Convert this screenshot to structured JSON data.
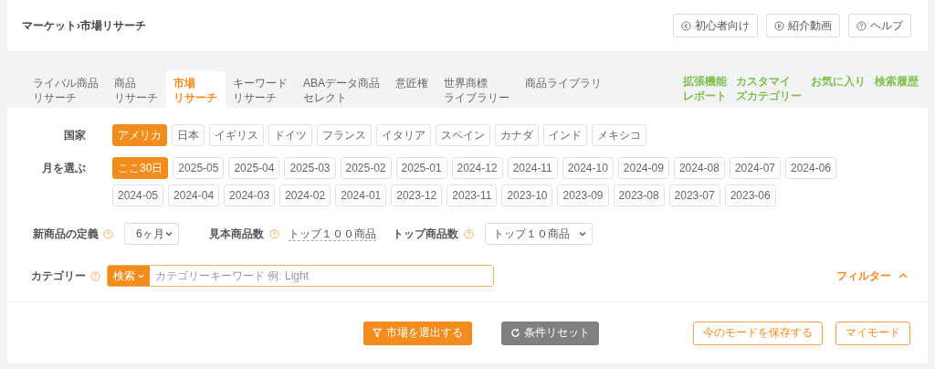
{
  "breadcrumb": "マーケット›市場リサーチ",
  "header_buttons": [
    {
      "label": "初心者向け",
      "kind": "back"
    },
    {
      "label": "紹介動画",
      "kind": "play"
    },
    {
      "label": "ヘルプ",
      "kind": "help"
    }
  ],
  "tabs": [
    {
      "lines": [
        "ライバル商品",
        "リサーチ"
      ],
      "selected": false
    },
    {
      "lines": [
        "商品",
        "リサーチ"
      ],
      "selected": false
    },
    {
      "lines": [
        "市場",
        "リサーチ"
      ],
      "selected": true
    },
    {
      "lines": [
        "キーワード",
        "リサーチ"
      ],
      "selected": false
    },
    {
      "lines": [
        "ABAデータ商品",
        "セレクト"
      ],
      "selected": false
    },
    {
      "lines": [
        "意匠権"
      ],
      "selected": false
    },
    {
      "lines": [
        "世界商標",
        "ライブラリー"
      ],
      "selected": false
    },
    {
      "lines": [
        "商品ライブラリ"
      ],
      "selected": false
    }
  ],
  "side_links": [
    {
      "lines": [
        "拡張機能",
        "レポート"
      ]
    },
    {
      "lines": [
        "カスタマイ",
        "ズカテゴリー"
      ]
    },
    {
      "lines": [
        "お気に入り"
      ]
    },
    {
      "lines": [
        "検索履歴"
      ]
    }
  ],
  "country": {
    "label": "国家",
    "options": [
      {
        "label": "アメリカ",
        "selected": true
      },
      {
        "label": "日本",
        "selected": false
      },
      {
        "label": "イギリス",
        "selected": false
      },
      {
        "label": "ドイツ",
        "selected": false
      },
      {
        "label": "フランス",
        "selected": false
      },
      {
        "label": "イタリア",
        "selected": false
      },
      {
        "label": "スペイン",
        "selected": false
      },
      {
        "label": "カナダ",
        "selected": false
      },
      {
        "label": "インド",
        "selected": false
      },
      {
        "label": "メキシコ",
        "selected": false
      }
    ]
  },
  "month": {
    "label": "月を選ぶ",
    "rows": [
      [
        {
          "label": "ここ30日",
          "selected": true
        },
        {
          "label": "2025-05",
          "selected": false
        },
        {
          "label": "2025-04",
          "selected": false
        },
        {
          "label": "2025-03",
          "selected": false
        },
        {
          "label": "2025-02",
          "selected": false
        },
        {
          "label": "2025-01",
          "selected": false
        },
        {
          "label": "2024-12",
          "selected": false
        },
        {
          "label": "2024-11",
          "selected": false
        },
        {
          "label": "2024-10",
          "selected": false
        },
        {
          "label": "2024-09",
          "selected": false
        },
        {
          "label": "2024-08",
          "selected": false
        },
        {
          "label": "2024-07",
          "selected": false
        },
        {
          "label": "2024-06",
          "selected": false
        }
      ],
      [
        {
          "label": "2024-05",
          "selected": false
        },
        {
          "label": "2024-04",
          "selected": false
        },
        {
          "label": "2024-03",
          "selected": false
        },
        {
          "label": "2024-02",
          "selected": false
        },
        {
          "label": "2024-01",
          "selected": false
        },
        {
          "label": "2023-12",
          "selected": false
        },
        {
          "label": "2023-11",
          "selected": false
        },
        {
          "label": "2023-10",
          "selected": false
        },
        {
          "label": "2023-09",
          "selected": false
        },
        {
          "label": "2023-08",
          "selected": false
        },
        {
          "label": "2023-07",
          "selected": false
        },
        {
          "label": "2023-06",
          "selected": false
        }
      ]
    ]
  },
  "new_product": {
    "label": "新商品の定義",
    "value": "6ヶ月"
  },
  "sample_count": {
    "label": "見本商品数",
    "value": "トップ１００商品"
  },
  "top_count": {
    "label": "トップ商品数",
    "value": "トップ１０商品"
  },
  "category": {
    "label": "カテゴリー",
    "mode": "検索",
    "placeholder": "カテゴリーキーワード 例: Light"
  },
  "filter_toggle": {
    "label": "フィルター",
    "expanded": true
  },
  "actions": {
    "submit": "市場を選出する",
    "reset": "条件リセット",
    "save": "今のモードを保存する",
    "mine": "マイモード"
  }
}
